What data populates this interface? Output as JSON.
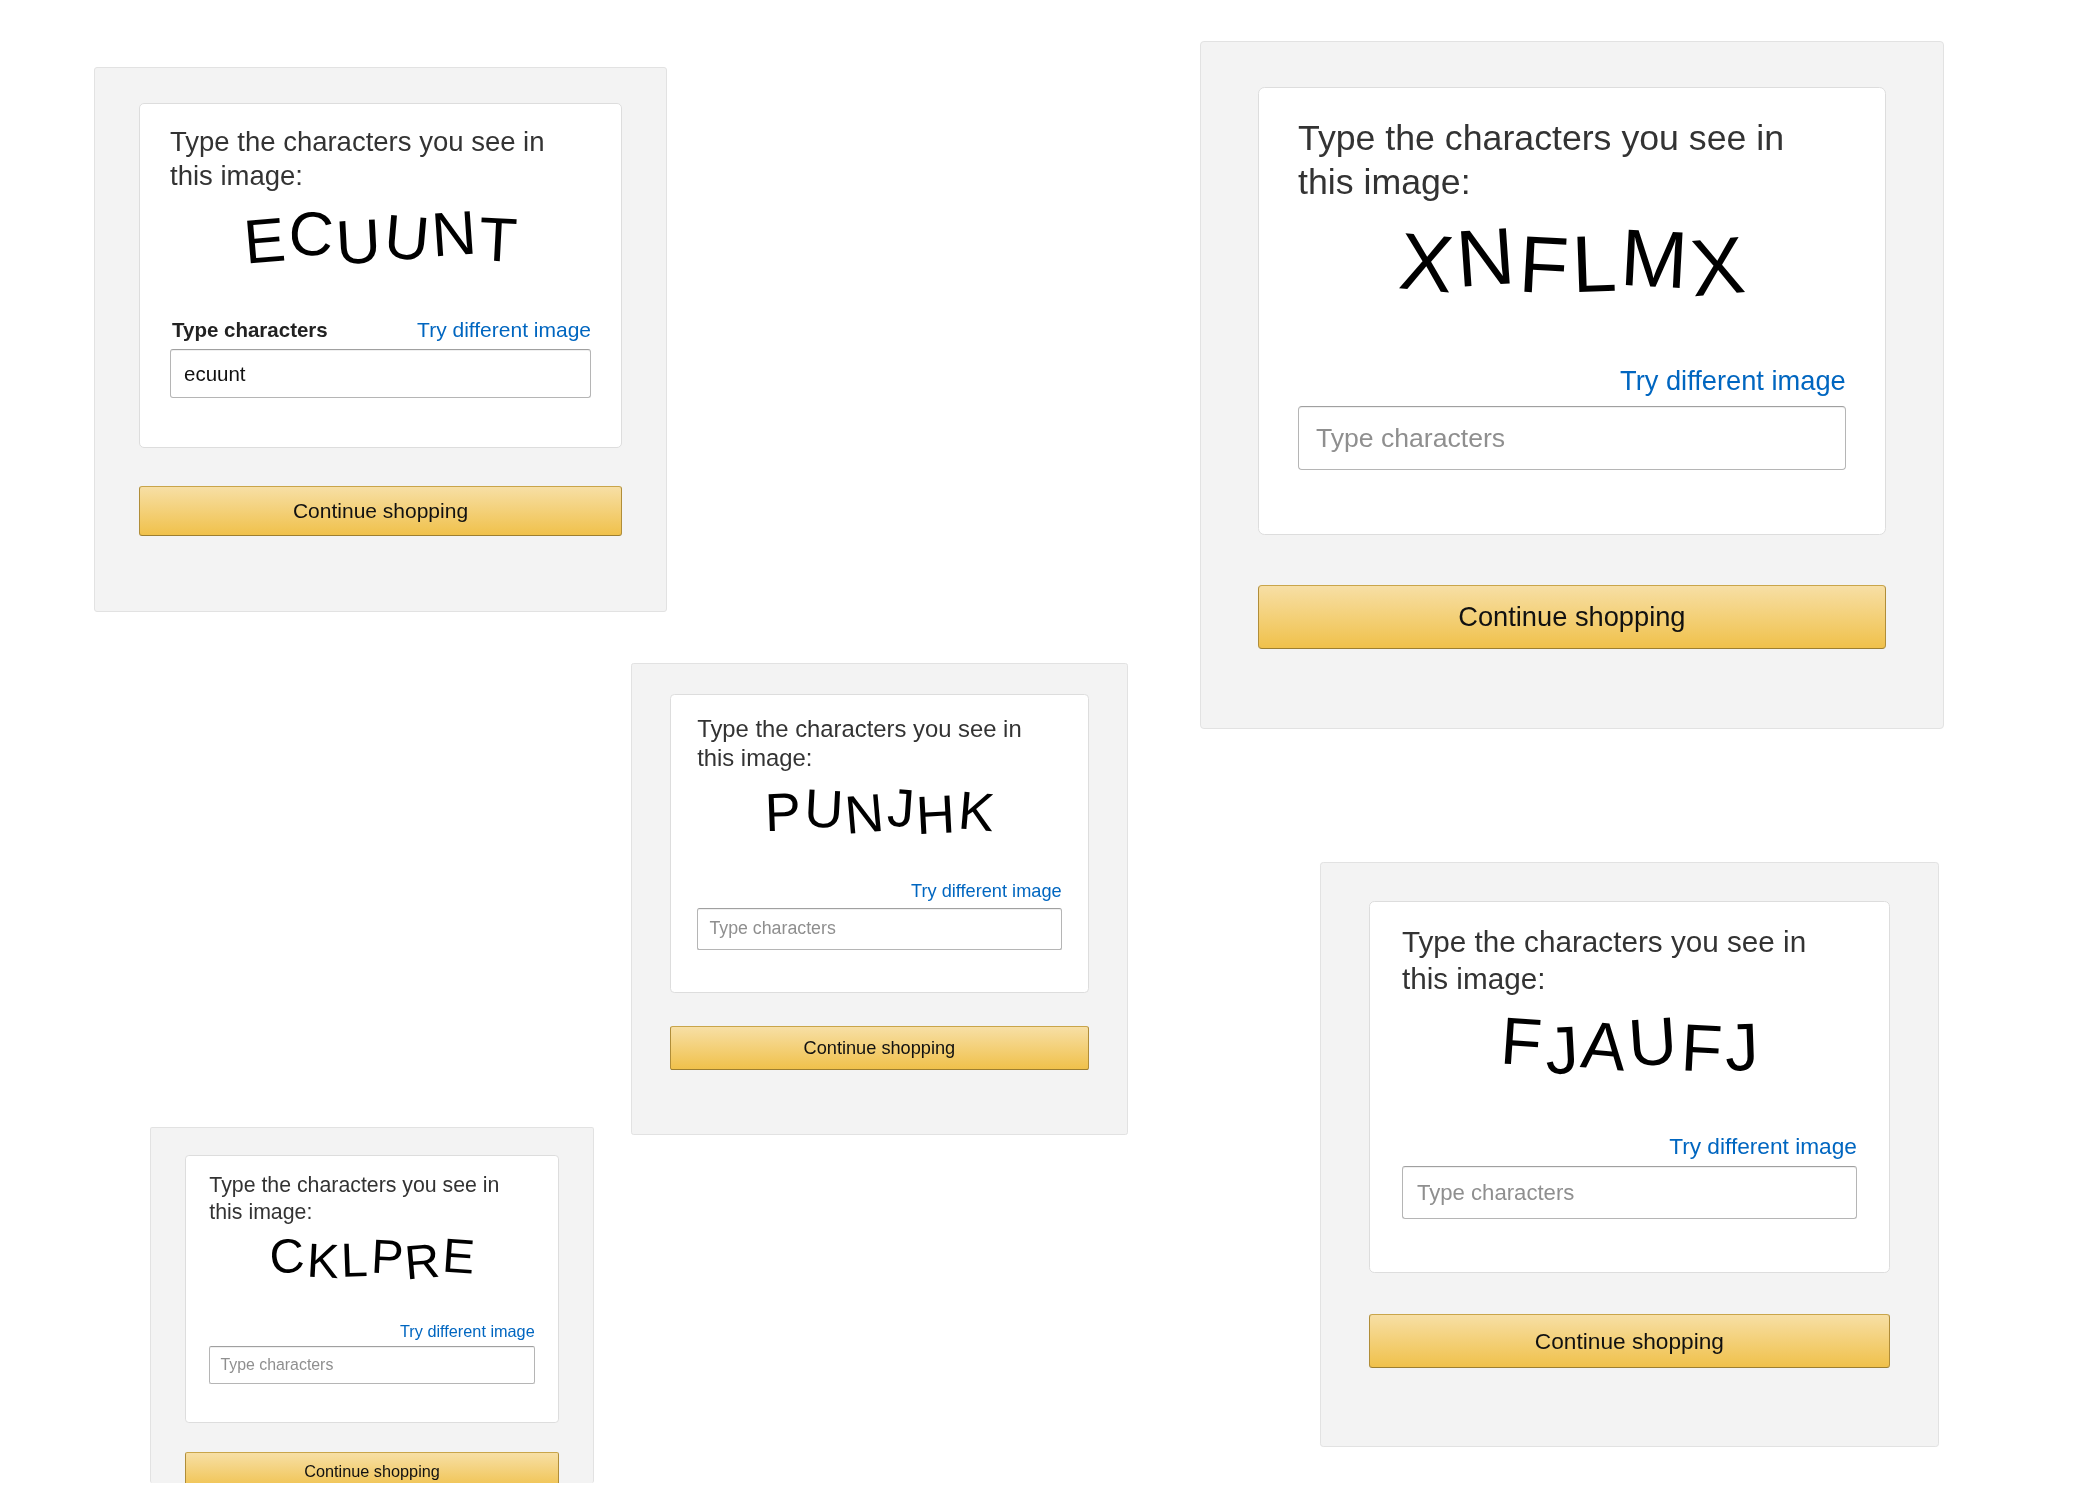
{
  "panels": [
    {
      "prompt": "Type the characters you see in this image:",
      "captcha": "ECUUNT",
      "field_label": "Type characters",
      "link": "Try different image",
      "input": {
        "value": "ecuunt"
      },
      "button": "Continue shopping"
    },
    {
      "prompt": "Type the characters you see in this image:",
      "captcha": "XNFLMX",
      "link": "Try different image",
      "input": {
        "placeholder": "Type characters"
      },
      "button": "Continue shopping"
    },
    {
      "prompt": "Type the characters you see in this image:",
      "captcha": "PUNJHK",
      "link": "Try different image",
      "input": {
        "placeholder": "Type characters"
      },
      "button": "Continue shopping"
    },
    {
      "prompt": "Type the characters you see in this image:",
      "captcha": "FJAUFJ",
      "link": "Try different image",
      "input": {
        "placeholder": "Type characters"
      },
      "button": "Continue shopping"
    },
    {
      "prompt": "Type the characters you see in this image:",
      "captcha": "CKLPRE",
      "link": "Try different image",
      "input": {
        "placeholder": "Type characters"
      },
      "button": "Continue shopping"
    }
  ]
}
